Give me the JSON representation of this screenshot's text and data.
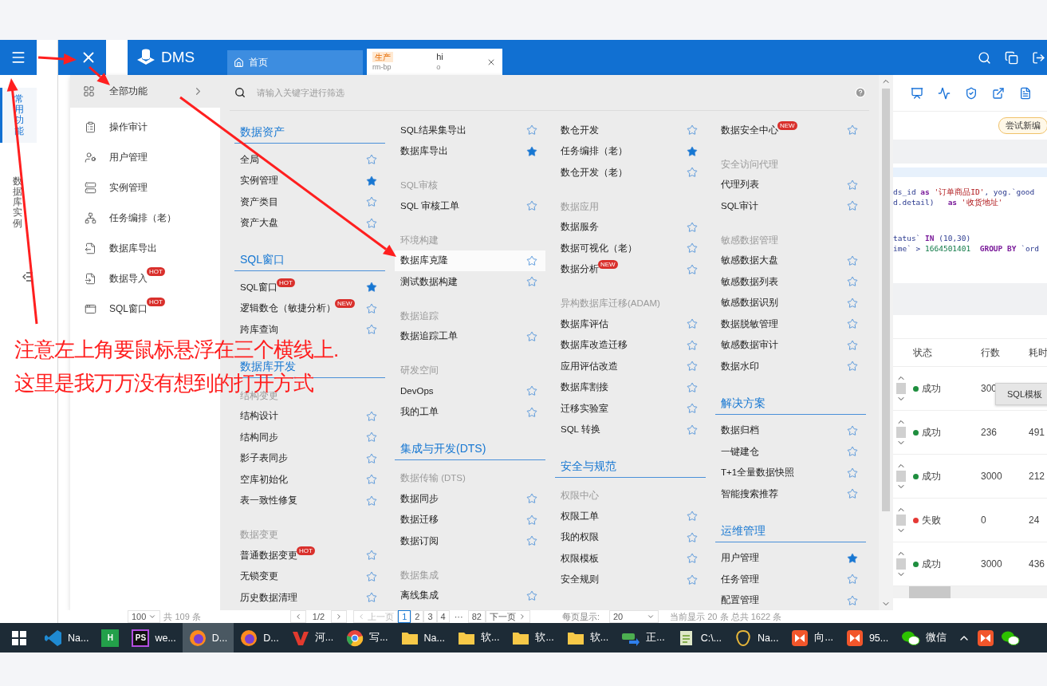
{
  "left_strip": {
    "tabs": [
      {
        "label": "常用功能",
        "selected": true
      },
      {
        "label": "数据库实例",
        "selected": false
      }
    ]
  },
  "header": {
    "logo": "DMS",
    "tabs": [
      {
        "kind": "home",
        "label": "首页",
        "selected": false
      },
      {
        "kind": "instance",
        "tag": "生产",
        "sublabel": "rm-bp",
        "label": "hi",
        "tail": "o",
        "selected": true
      }
    ]
  },
  "menu": {
    "title": "全部功能",
    "quick_items": [
      {
        "label": "操作审计"
      },
      {
        "label": "用户管理"
      },
      {
        "label": "实例管理"
      },
      {
        "label": "任务编排（老）"
      },
      {
        "label": "数据库导出"
      },
      {
        "label": "数据导入",
        "badge": "HOT"
      },
      {
        "label": "SQL窗口",
        "badge": "HOT"
      }
    ],
    "search": {
      "placeholder": "请输入关键字进行筛选"
    },
    "columns": [
      {
        "entries": [
          {
            "kind": "section",
            "label": "数据资产"
          },
          {
            "kind": "item",
            "label": "全局",
            "starred": false
          },
          {
            "kind": "item",
            "label": "实例管理",
            "starred": true
          },
          {
            "kind": "item",
            "label": "资产类目",
            "starred": false
          },
          {
            "kind": "item",
            "label": "资产大盘",
            "starred": false
          },
          {
            "kind": "section",
            "label": "SQL窗口"
          },
          {
            "kind": "item",
            "label": "SQL窗口",
            "badge": "HOT",
            "starred": true
          },
          {
            "kind": "item",
            "label": "逻辑数仓（敏捷分析）",
            "badge": "NEW",
            "starred": false
          },
          {
            "kind": "item",
            "label": "跨库查询",
            "starred": false
          },
          {
            "kind": "section",
            "label": "数据库开发"
          },
          {
            "kind": "group",
            "label": "结构变更"
          },
          {
            "kind": "item",
            "label": "结构设计",
            "starred": false
          },
          {
            "kind": "item",
            "label": "结构同步",
            "starred": false
          },
          {
            "kind": "item",
            "label": "影子表同步",
            "starred": false
          },
          {
            "kind": "item",
            "label": "空库初始化",
            "starred": false
          },
          {
            "kind": "item",
            "label": "表一致性修复",
            "starred": false
          },
          {
            "kind": "group",
            "label": "数据变更"
          },
          {
            "kind": "item",
            "label": "普通数据变更",
            "badge": "HOT",
            "starred": false
          },
          {
            "kind": "item",
            "label": "无锁变更",
            "starred": false
          },
          {
            "kind": "item",
            "label": "历史数据清理",
            "starred": false
          }
        ]
      },
      {
        "entries": [
          {
            "kind": "item",
            "label": "SQL结果集导出",
            "starred": false
          },
          {
            "kind": "item",
            "label": "数据库导出",
            "starred": true
          },
          {
            "kind": "group",
            "label": "SQL审核"
          },
          {
            "kind": "item",
            "label": "SQL 审核工单",
            "starred": false
          },
          {
            "kind": "group",
            "label": "环境构建"
          },
          {
            "kind": "item",
            "label": "数据库克隆",
            "starred": false,
            "highlighted": true
          },
          {
            "kind": "item",
            "label": "测试数据构建",
            "starred": false
          },
          {
            "kind": "group",
            "label": "数据追踪"
          },
          {
            "kind": "item",
            "label": "数据追踪工单",
            "starred": false
          },
          {
            "kind": "group",
            "label": "研发空间"
          },
          {
            "kind": "item",
            "label": "DevOps",
            "starred": false
          },
          {
            "kind": "item",
            "label": "我的工单",
            "starred": false
          },
          {
            "kind": "section",
            "label": "集成与开发(DTS)"
          },
          {
            "kind": "group",
            "label": "数据传输 (DTS)"
          },
          {
            "kind": "item",
            "label": "数据同步",
            "starred": false
          },
          {
            "kind": "item",
            "label": "数据迁移",
            "starred": false
          },
          {
            "kind": "item",
            "label": "数据订阅",
            "starred": false
          },
          {
            "kind": "group",
            "label": "数据集成"
          },
          {
            "kind": "item",
            "label": "离线集成",
            "starred": false
          }
        ]
      },
      {
        "entries": [
          {
            "kind": "item",
            "label": "数仓开发",
            "starred": false
          },
          {
            "kind": "item",
            "label": "任务编排（老）",
            "starred": true
          },
          {
            "kind": "item",
            "label": "数仓开发（老）",
            "starred": false
          },
          {
            "kind": "group",
            "label": "数据应用"
          },
          {
            "kind": "item",
            "label": "数据服务",
            "starred": false
          },
          {
            "kind": "item",
            "label": "数据可视化（老）",
            "starred": false
          },
          {
            "kind": "item",
            "label": "数据分析",
            "badge": "NEW",
            "starred": false
          },
          {
            "kind": "group",
            "label": "异构数据库迁移(ADAM)"
          },
          {
            "kind": "item",
            "label": "数据库评估",
            "starred": false
          },
          {
            "kind": "item",
            "label": "数据库改造迁移",
            "starred": false
          },
          {
            "kind": "item",
            "label": "应用评估改造",
            "starred": false
          },
          {
            "kind": "item",
            "label": "数据库割接",
            "starred": false
          },
          {
            "kind": "item",
            "label": "迁移实验室",
            "starred": false
          },
          {
            "kind": "item",
            "label": "SQL 转换",
            "starred": false
          },
          {
            "kind": "section",
            "label": "安全与规范"
          },
          {
            "kind": "group",
            "label": "权限中心"
          },
          {
            "kind": "item",
            "label": "权限工单",
            "starred": false
          },
          {
            "kind": "item",
            "label": "我的权限",
            "starred": false
          },
          {
            "kind": "item",
            "label": "权限模板",
            "starred": false
          },
          {
            "kind": "item",
            "label": "安全规则",
            "starred": false
          }
        ]
      },
      {
        "entries": [
          {
            "kind": "item",
            "label": "数据安全中心",
            "badge": "NEW",
            "starred": false
          },
          {
            "kind": "group",
            "label": "安全访问代理"
          },
          {
            "kind": "item",
            "label": "代理列表",
            "starred": false
          },
          {
            "kind": "item",
            "label": "SQL审计",
            "starred": false
          },
          {
            "kind": "group",
            "label": "敏感数据管理"
          },
          {
            "kind": "item",
            "label": "敏感数据大盘",
            "starred": false
          },
          {
            "kind": "item",
            "label": "敏感数据列表",
            "starred": false
          },
          {
            "kind": "item",
            "label": "敏感数据识别",
            "starred": false
          },
          {
            "kind": "item",
            "label": "数据脱敏管理",
            "starred": false
          },
          {
            "kind": "item",
            "label": "敏感数据审计",
            "starred": false
          },
          {
            "kind": "item",
            "label": "数据水印",
            "starred": false
          },
          {
            "kind": "section",
            "label": "解决方案"
          },
          {
            "kind": "item",
            "label": "数据归档",
            "starred": false
          },
          {
            "kind": "item",
            "label": "一键建仓",
            "starred": false
          },
          {
            "kind": "item",
            "label": "T+1全量数据快照",
            "starred": false
          },
          {
            "kind": "item",
            "label": "智能搜索推荐",
            "starred": false
          },
          {
            "kind": "section",
            "label": "运维管理"
          },
          {
            "kind": "item",
            "label": "用户管理",
            "starred": true
          },
          {
            "kind": "item",
            "label": "任务管理",
            "starred": false
          },
          {
            "kind": "item",
            "label": "配置管理",
            "starred": false
          }
        ]
      }
    ]
  },
  "workspace": {
    "try_button": "尝试新编",
    "code": [
      [
        {
          "kind": "plain",
          "t": "ds_id "
        },
        {
          "kind": "keyword",
          "t": "as"
        },
        {
          "kind": "string",
          "t": " '订单商品ID'"
        },
        {
          "kind": "plain",
          "t": ", yog.`good"
        }
      ],
      [
        {
          "kind": "plain",
          "t": "d.detail)   "
        },
        {
          "kind": "keyword",
          "t": "as"
        },
        {
          "kind": "string",
          "t": " '收货地址'"
        }
      ],
      [
        {
          "kind": "plain",
          "t": "tatus` "
        },
        {
          "kind": "keyword",
          "t": "IN"
        },
        {
          "kind": "plain",
          "t": " (10,30)"
        }
      ],
      [
        {
          "kind": "plain",
          "t": "ime` > "
        },
        {
          "kind": "number",
          "t": "1664501401"
        },
        {
          "kind": "keyword",
          "t": "  GROUP BY"
        },
        {
          "kind": "plain",
          "t": " `ord"
        }
      ]
    ],
    "table": {
      "columns": [
        "状态",
        "行数",
        "耗时"
      ],
      "rows": [
        {
          "status": "成功",
          "color": "#1e8e3e",
          "count": "300"
        },
        {
          "status": "成功",
          "color": "#1e8e3e",
          "count": "236",
          "time": "491"
        },
        {
          "status": "成功",
          "color": "#1e8e3e",
          "count": "3000",
          "time": "212"
        },
        {
          "status": "失败",
          "color": "#e53935",
          "count": "0",
          "time": "24"
        },
        {
          "status": "成功",
          "color": "#1e8e3e",
          "count": "3000",
          "time": "436"
        }
      ]
    },
    "template_button": "SQL模板"
  },
  "pagination": {
    "page_size": "100",
    "total": "共 109 条",
    "page_info": "1/2",
    "prev": "上一页",
    "pages": [
      {
        "label": "1",
        "selected": true
      },
      {
        "label": "2",
        "selected": false
      },
      {
        "label": "3",
        "selected": false
      },
      {
        "label": "4",
        "selected": false
      }
    ],
    "ellipsis": "···",
    "last": "82",
    "next": "下一页",
    "per_page_label": "每页显示:",
    "per_page": "20",
    "summary": "当前显示 20 条 总共 1622 条"
  },
  "taskbar": {
    "apps": [
      {
        "kind": "code",
        "label": "Na...",
        "selected": false
      },
      {
        "kind": "letter",
        "icon_text": "H",
        "selected": false
      },
      {
        "kind": "letter-dark",
        "icon_text": "PS",
        "label": "we...",
        "selected": false
      },
      {
        "kind": "fox",
        "label": "D...",
        "selected": true
      },
      {
        "kind": "fox",
        "label": "D...",
        "selected": false
      },
      {
        "kind": "wps",
        "label": "河...",
        "selected": false
      },
      {
        "kind": "chrome",
        "label": "写...",
        "selected": false
      },
      {
        "kind": "folder",
        "label": "Na...",
        "selected": false
      },
      {
        "kind": "folder",
        "label": "软...",
        "selected": false
      },
      {
        "kind": "folder",
        "label": "软...",
        "selected": false
      },
      {
        "kind": "folder",
        "label": "软...",
        "selected": false
      },
      {
        "kind": "transfer",
        "label": "正...",
        "selected": false
      },
      {
        "kind": "notepad",
        "label": "C:\\...",
        "selected": false
      },
      {
        "kind": "ring",
        "label": "Na...",
        "selected": false
      },
      {
        "kind": "orange",
        "label": "向...",
        "selected": false
      },
      {
        "kind": "orange",
        "label": "95...",
        "selected": false
      },
      {
        "kind": "chat",
        "label": "微信",
        "selected": false
      }
    ],
    "tray": [
      {
        "kind": "orange"
      },
      {
        "kind": "chat"
      }
    ]
  },
  "annotation": {
    "lines": [
      "注意左上角要鼠标悬浮在三个横线上.",
      "这里是我万万没有想到的打开方式"
    ]
  }
}
